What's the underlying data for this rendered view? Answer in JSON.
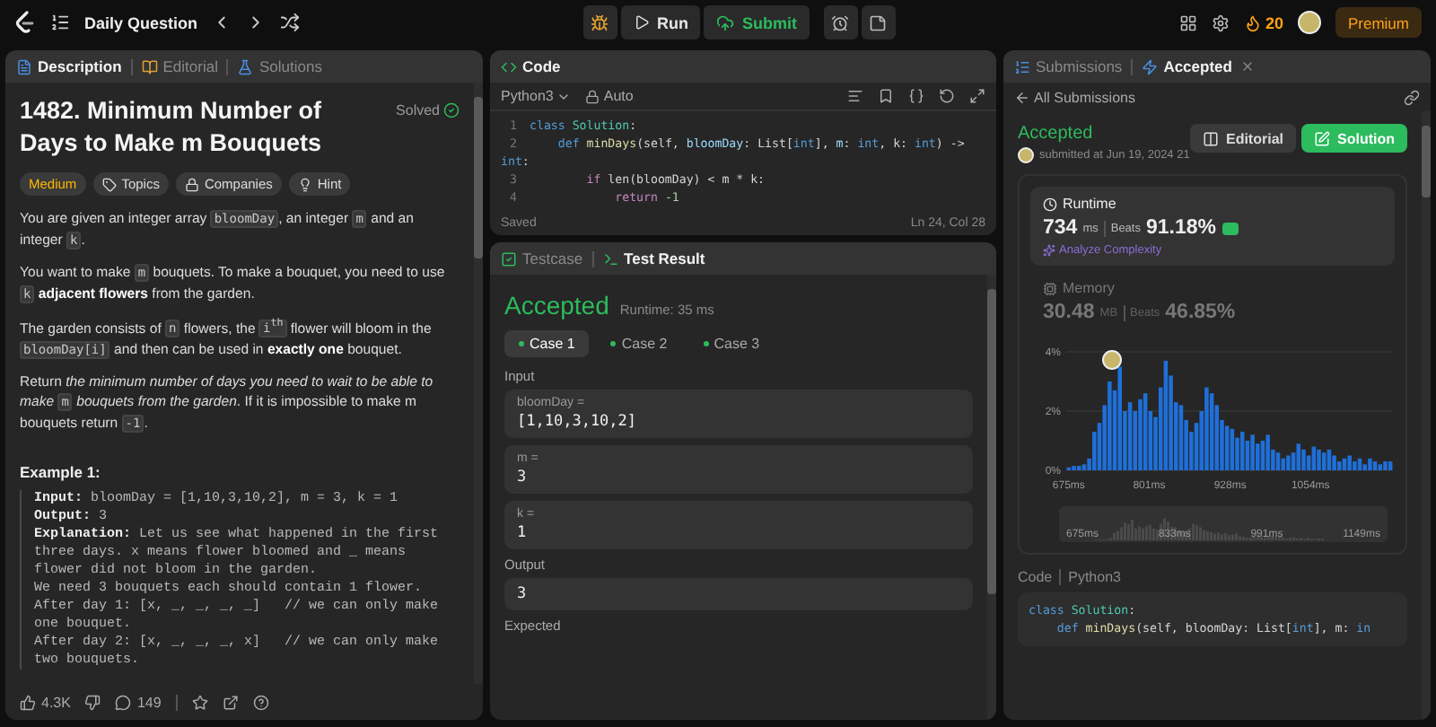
{
  "topbar": {
    "title": "Daily Question",
    "run": "Run",
    "submit": "Submit",
    "streak": "20",
    "premium": "Premium"
  },
  "description_panel": {
    "tabs": [
      {
        "label": "Description",
        "selected": true
      },
      {
        "label": "Editorial",
        "selected": false
      },
      {
        "label": "Solutions",
        "selected": false
      }
    ],
    "title": "1482. Minimum Number of Days to Make m Bouquets",
    "status": "Solved",
    "tags": [
      {
        "label": "Medium",
        "kind": "difficulty"
      },
      {
        "label": "Topics",
        "kind": "topics"
      },
      {
        "label": "Companies",
        "kind": "companies"
      },
      {
        "label": "Hint",
        "kind": "hint"
      }
    ],
    "paragraphs": [
      [
        {
          "kind": "text",
          "text": "You are given an integer array "
        },
        {
          "kind": "code",
          "text": "bloomDay"
        },
        {
          "kind": "text",
          "text": ", an integer "
        },
        {
          "kind": "code",
          "text": "m"
        },
        {
          "kind": "text",
          "text": " and an integer "
        },
        {
          "kind": "code",
          "text": "k"
        },
        {
          "kind": "text",
          "text": "."
        }
      ],
      [
        {
          "kind": "text",
          "text": "You want to make "
        },
        {
          "kind": "code",
          "text": "m"
        },
        {
          "kind": "text",
          "text": " bouquets. To make a bouquet, you need to use "
        },
        {
          "kind": "code",
          "text": "k"
        },
        {
          "kind": "bold",
          "text": " adjacent flowers"
        },
        {
          "kind": "text",
          "text": " from the garden."
        }
      ],
      [
        {
          "kind": "text",
          "text": "The garden consists of "
        },
        {
          "kind": "code",
          "text": "n"
        },
        {
          "kind": "text",
          "text": " flowers, the "
        },
        {
          "kind": "code",
          "text": "i$^{th}$"
        },
        {
          "kind": "text",
          "text": " flower will bloom in the "
        },
        {
          "kind": "code",
          "text": "bloomDay[i]"
        },
        {
          "kind": "text",
          "text": " and then can be used in "
        },
        {
          "kind": "bold",
          "text": "exactly one"
        },
        {
          "kind": "text",
          "text": " bouquet."
        }
      ],
      [
        {
          "kind": "text",
          "text": "Return "
        },
        {
          "kind": "italic",
          "text": "the minimum number of days you need to wait to be able to make "
        },
        {
          "kind": "code",
          "text": "m"
        },
        {
          "kind": "italic",
          "text": " bouquets from the garden"
        },
        {
          "kind": "text",
          "text": ". If it is impossible to make m bouquets return "
        },
        {
          "kind": "code",
          "text": "-1"
        },
        {
          "kind": "text",
          "text": "."
        }
      ]
    ],
    "example": {
      "heading": "Example 1:",
      "lines": [
        "**Input:** bloomDay = [1,10,3,10,2], m = 3, k = 1",
        "**Output:** 3",
        "**Explanation:** Let us see what happened in the first",
        "three days. x means flower bloomed and _ means",
        "flower did not bloom in the garden.",
        "We need 3 bouquets each should contain 1 flower.",
        "After day 1: [x, _, _, _, _]   // we can only make",
        "one bouquet.",
        "After day 2: [x, _, _, _, x]   // we can only make",
        "two bouquets."
      ]
    },
    "footer": {
      "likes": "4.3K",
      "comments": "149"
    }
  },
  "code_panel": {
    "title": "Code",
    "language": "Python3",
    "mode": "Auto",
    "status": "Saved",
    "cursor": "Ln 24, Col 28",
    "lines": [
      {
        "num": "1",
        "tokens": [
          {
            "kind": "kw",
            "text": "class "
          },
          {
            "kind": "cls",
            "text": "Solution"
          },
          {
            "kind": "p",
            "text": ":"
          }
        ]
      },
      {
        "num": "2",
        "tokens": [
          {
            "kind": "kw",
            "text": "    def "
          },
          {
            "kind": "fn",
            "text": "minDays"
          },
          {
            "kind": "p",
            "text": "(self, "
          },
          {
            "kind": "param",
            "text": "bloomDay"
          },
          {
            "kind": "p",
            "text": ": List["
          },
          {
            "kind": "kw",
            "text": "int"
          },
          {
            "kind": "p",
            "text": "], "
          },
          {
            "kind": "param",
            "text": "m"
          },
          {
            "kind": "p",
            "text": ": "
          },
          {
            "kind": "kw",
            "text": "int"
          },
          {
            "kind": "p",
            "text": ", k: "
          },
          {
            "kind": "kw",
            "text": "int"
          },
          {
            "kind": "p",
            "text": ") ->"
          }
        ]
      },
      {
        "tokens": [
          {
            "kind": "kw",
            "text": "int"
          },
          {
            "kind": "p",
            "text": ":"
          }
        ]
      },
      {
        "num": "3",
        "tokens": [
          {
            "kind": "ctl",
            "text": "        if "
          },
          {
            "kind": "p",
            "text": "len(bloomDay) < m * k:"
          }
        ]
      },
      {
        "num": "4",
        "tokens": [
          {
            "kind": "ctl",
            "text": "            return "
          },
          {
            "kind": "num",
            "text": "-1"
          }
        ]
      }
    ]
  },
  "result_panel": {
    "tabs": [
      {
        "label": "Testcase",
        "selected": false
      },
      {
        "label": "Test Result",
        "selected": true
      }
    ],
    "verdict": "Accepted",
    "runtime": "Runtime: 35 ms",
    "cases": [
      {
        "label": "Case 1",
        "selected": true
      },
      {
        "label": "Case 2",
        "selected": false
      },
      {
        "label": "Case 3",
        "selected": false
      }
    ],
    "input_label": "Input",
    "inputs": [
      {
        "name": "bloomDay =",
        "value": "[1,10,3,10,2]"
      },
      {
        "name": "m =",
        "value": "3"
      },
      {
        "name": "k =",
        "value": "1"
      }
    ],
    "output_label": "Output",
    "output": "3",
    "expected_label": "Expected"
  },
  "submission_panel": {
    "tabs": [
      {
        "label": "Submissions",
        "selected": false
      },
      {
        "label": "Accepted",
        "selected": true
      }
    ],
    "back": "All Submissions",
    "verdict": "Accepted",
    "submitted": "submitted at Jun 19, 2024 21",
    "editorial": "Editorial",
    "solution": "Solution",
    "metrics": [
      {
        "kind": "runtime",
        "label": "Runtime",
        "value": "734",
        "unit": "ms",
        "beats_label": "Beats",
        "beats": "91.18%",
        "link": "Analyze Complexity",
        "selected": true
      },
      {
        "kind": "memory",
        "label": "Memory",
        "value": "30.48",
        "unit": "MB",
        "beats_label": "Beats",
        "beats": "46.85%",
        "selected": false
      }
    ],
    "chart_data": {
      "type": "bar",
      "x": [
        675,
        683,
        691,
        699,
        707,
        715,
        723,
        731,
        739,
        747,
        755,
        763,
        771,
        779,
        787,
        795,
        803,
        811,
        819,
        827,
        835,
        843,
        851,
        859,
        867,
        875,
        883,
        891,
        899,
        907,
        915,
        923,
        931,
        939,
        947,
        955,
        963,
        971,
        979,
        987,
        995,
        1003,
        1011,
        1019,
        1027,
        1035,
        1043,
        1051,
        1059,
        1067,
        1075,
        1083,
        1091,
        1099,
        1107,
        1115,
        1123,
        1131,
        1139,
        1147,
        1155,
        1163,
        1171,
        1179
      ],
      "series": [
        {
          "color": "#1f6fd8",
          "values": [
            0.1,
            0.15,
            0.15,
            0.2,
            0.4,
            1.3,
            1.6,
            2.2,
            3.0,
            2.7,
            3.5,
            2.0,
            2.3,
            2.0,
            2.4,
            2.6,
            2.0,
            1.8,
            2.8,
            3.7,
            3.2,
            2.3,
            2.2,
            1.7,
            1.3,
            1.6,
            2.0,
            2.8,
            2.6,
            2.2,
            1.7,
            1.5,
            1.4,
            1.1,
            1.3,
            1.0,
            1.2,
            0.9,
            1.0,
            1.2,
            0.7,
            0.6,
            0.4,
            0.5,
            0.6,
            0.9,
            0.7,
            0.5,
            0.8,
            0.7,
            0.6,
            0.7,
            0.5,
            0.3,
            0.4,
            0.5,
            0.3,
            0.4,
            0.2,
            0.4,
            0.3,
            0.2,
            0.3,
            0.3
          ]
        }
      ],
      "xlim": [
        671,
        1183
      ],
      "ylim": [
        0,
        4
      ],
      "yticks": [
        {
          "value": 0,
          "label": "0%"
        },
        {
          "value": 2,
          "label": "2%"
        },
        {
          "value": 4,
          "label": "4%"
        }
      ],
      "xticks": [
        {
          "value": 675,
          "label": "675ms"
        },
        {
          "value": 801,
          "label": "801ms"
        },
        {
          "value": 928,
          "label": "928ms"
        },
        {
          "value": 1054,
          "label": "1054ms"
        }
      ]
    },
    "navigator_labels": [
      "675ms",
      "833ms",
      "991ms",
      "1149ms"
    ],
    "code_title": "Code",
    "code_language": "Python3",
    "code_lines": [
      [
        {
          "kind": "kw",
          "text": "class "
        },
        {
          "kind": "cls",
          "text": "Solution"
        },
        {
          "kind": "p",
          "text": ":"
        }
      ],
      [
        {
          "kind": "kw",
          "text": "    def "
        },
        {
          "kind": "fn",
          "text": "minDays"
        },
        {
          "kind": "p",
          "text": "(self, bloomDay: List["
        },
        {
          "kind": "kw",
          "text": "int"
        },
        {
          "kind": "p",
          "text": "], m: "
        },
        {
          "kind": "kw",
          "text": "in"
        }
      ]
    ]
  }
}
